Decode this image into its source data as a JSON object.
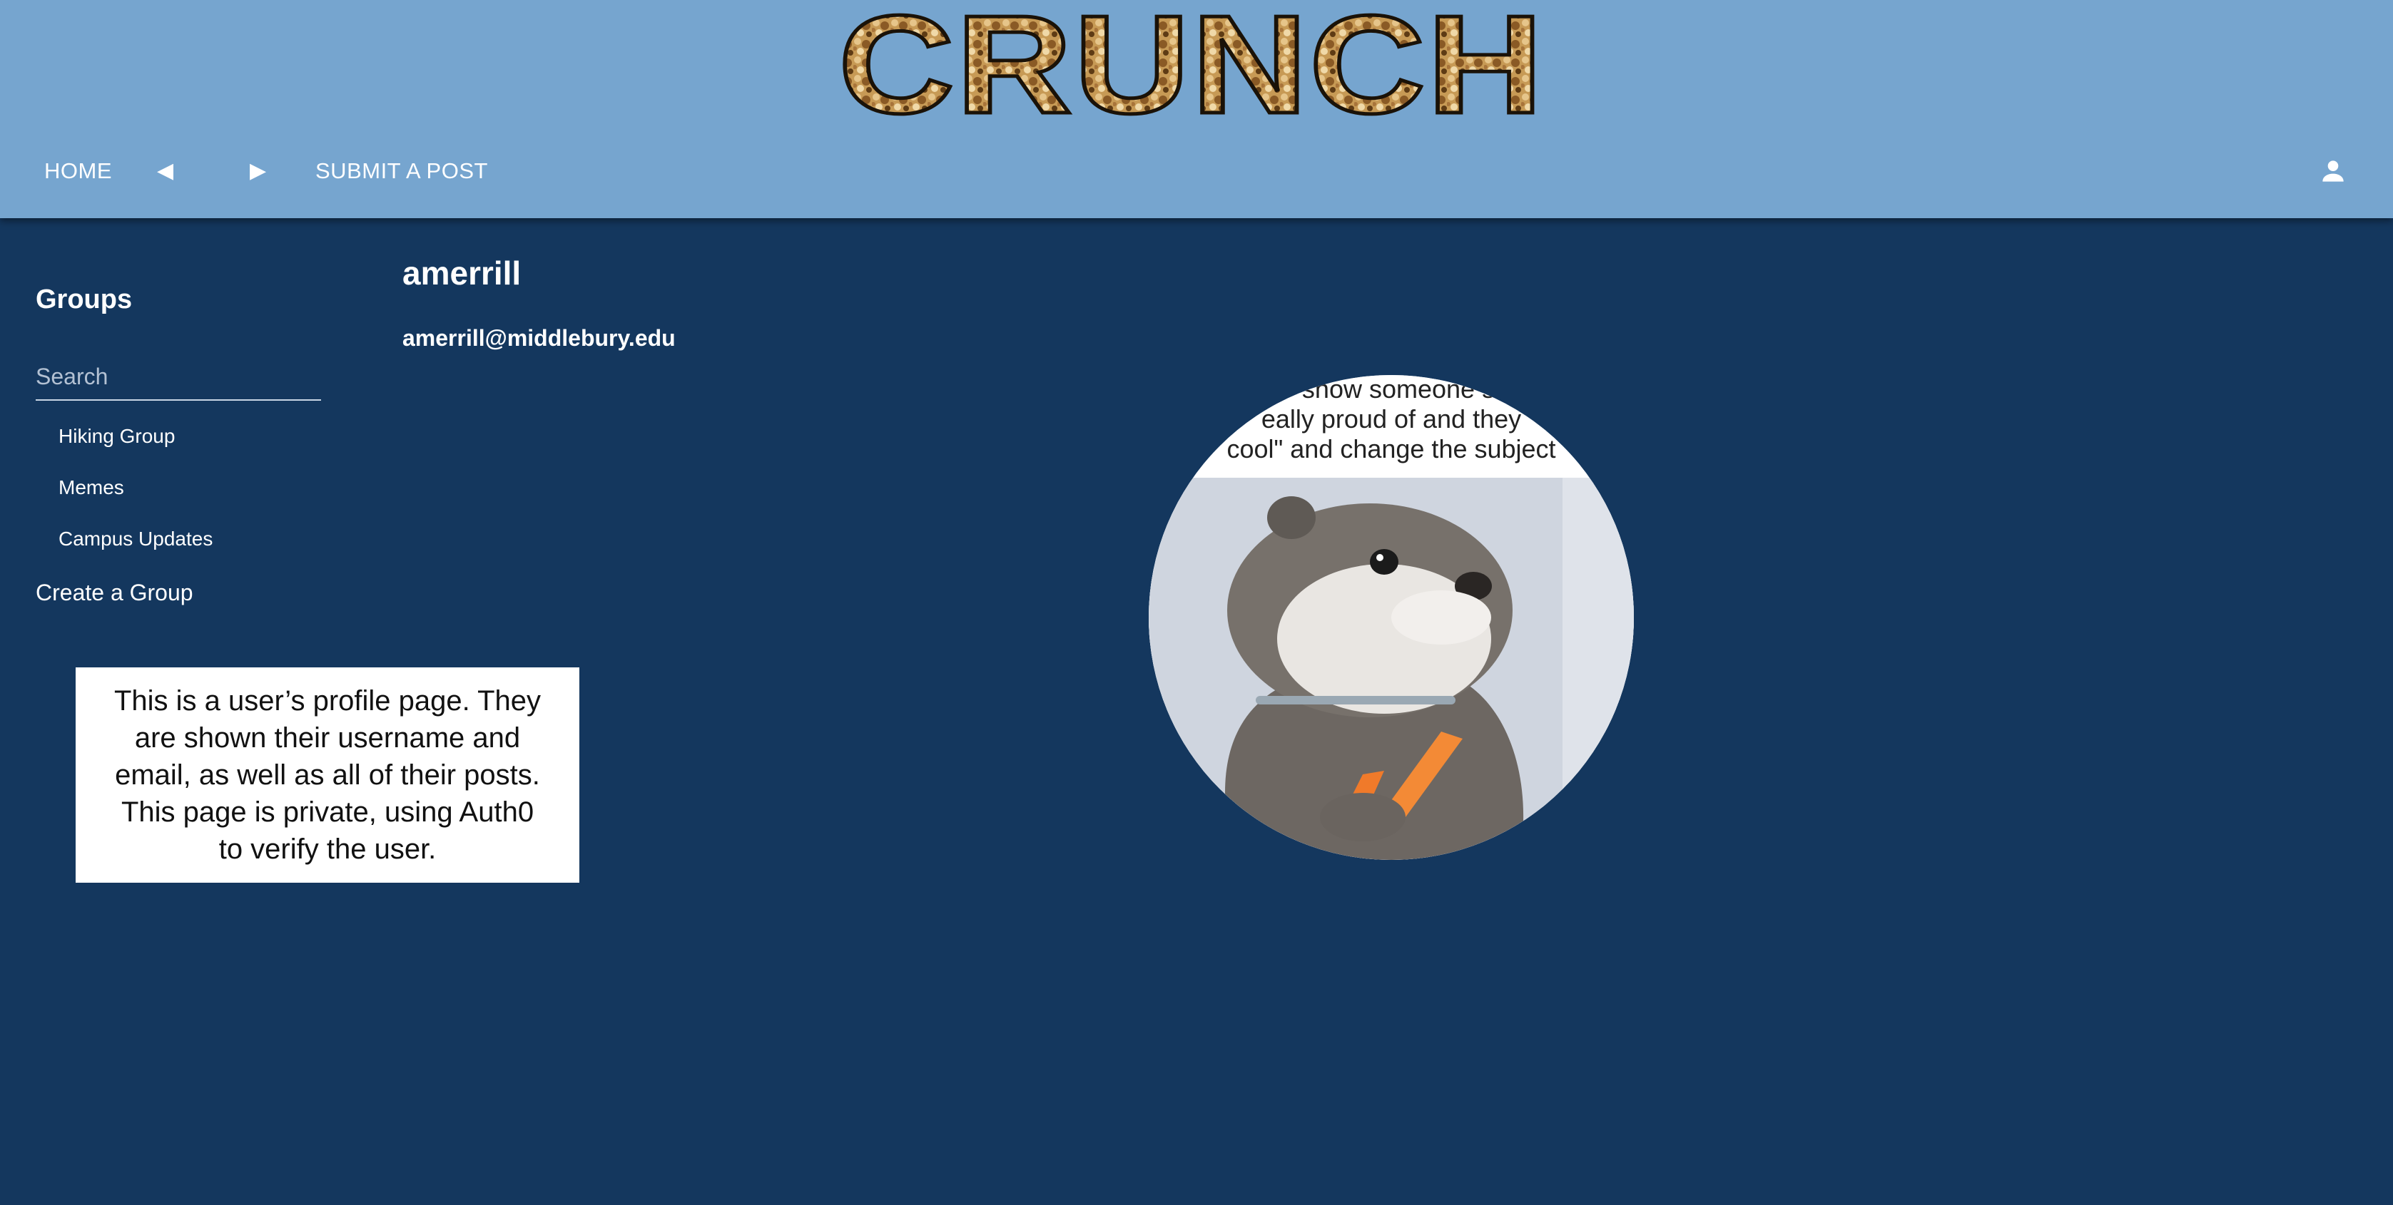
{
  "header": {
    "logo_text": "CRUNCH",
    "nav": {
      "home": "HOME",
      "back": "◀",
      "forward": "▶",
      "submit": "SUBMIT A POST"
    },
    "account_icon": "person-icon"
  },
  "sidebar": {
    "title": "Groups",
    "search_placeholder": "Search",
    "groups": [
      "Hiking Group",
      "Memes",
      "Campus Updates"
    ],
    "create_group": "Create a Group"
  },
  "profile": {
    "username": "amerrill",
    "email": "amerrill@middlebury.edu",
    "avatar_caption": [
      "show someone s",
      "eally proud of and they",
      "cool\" and change the subject"
    ]
  },
  "note": "This is a user’s profile page. They are shown their username and email, as well as all of their posts. This page is private, using Auth0 to verify the user."
}
